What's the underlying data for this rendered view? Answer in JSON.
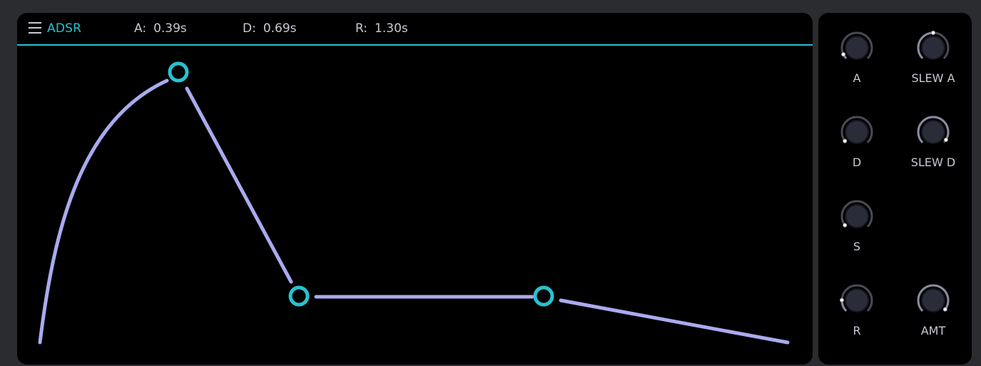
{
  "header": {
    "title": "ADSR",
    "params": [
      {
        "label": "A:",
        "value": "0.39s"
      },
      {
        "label": "D:",
        "value": "0.69s"
      },
      {
        "label": "R:",
        "value": "1.30s"
      }
    ]
  },
  "colors": {
    "accent": "#27c3cf",
    "curve": "#aaaaee",
    "panel": "#000000",
    "background": "#2b2c30",
    "knob_body": "#2a2c3a",
    "knob_ring": "#4a4a52"
  },
  "icons": {
    "menu": "hamburger-icon"
  },
  "knobs": [
    {
      "label": "A",
      "value": 0.07
    },
    {
      "label": "SLEW A",
      "value": 0.5
    },
    {
      "label": "D",
      "value": 0.03
    },
    {
      "label": "SLEW D",
      "value": 0.95
    },
    {
      "label": "S",
      "value": 0.03
    },
    {
      "label": "R",
      "value": 0.17
    },
    {
      "label": "AMT",
      "value": 0.97
    }
  ]
}
